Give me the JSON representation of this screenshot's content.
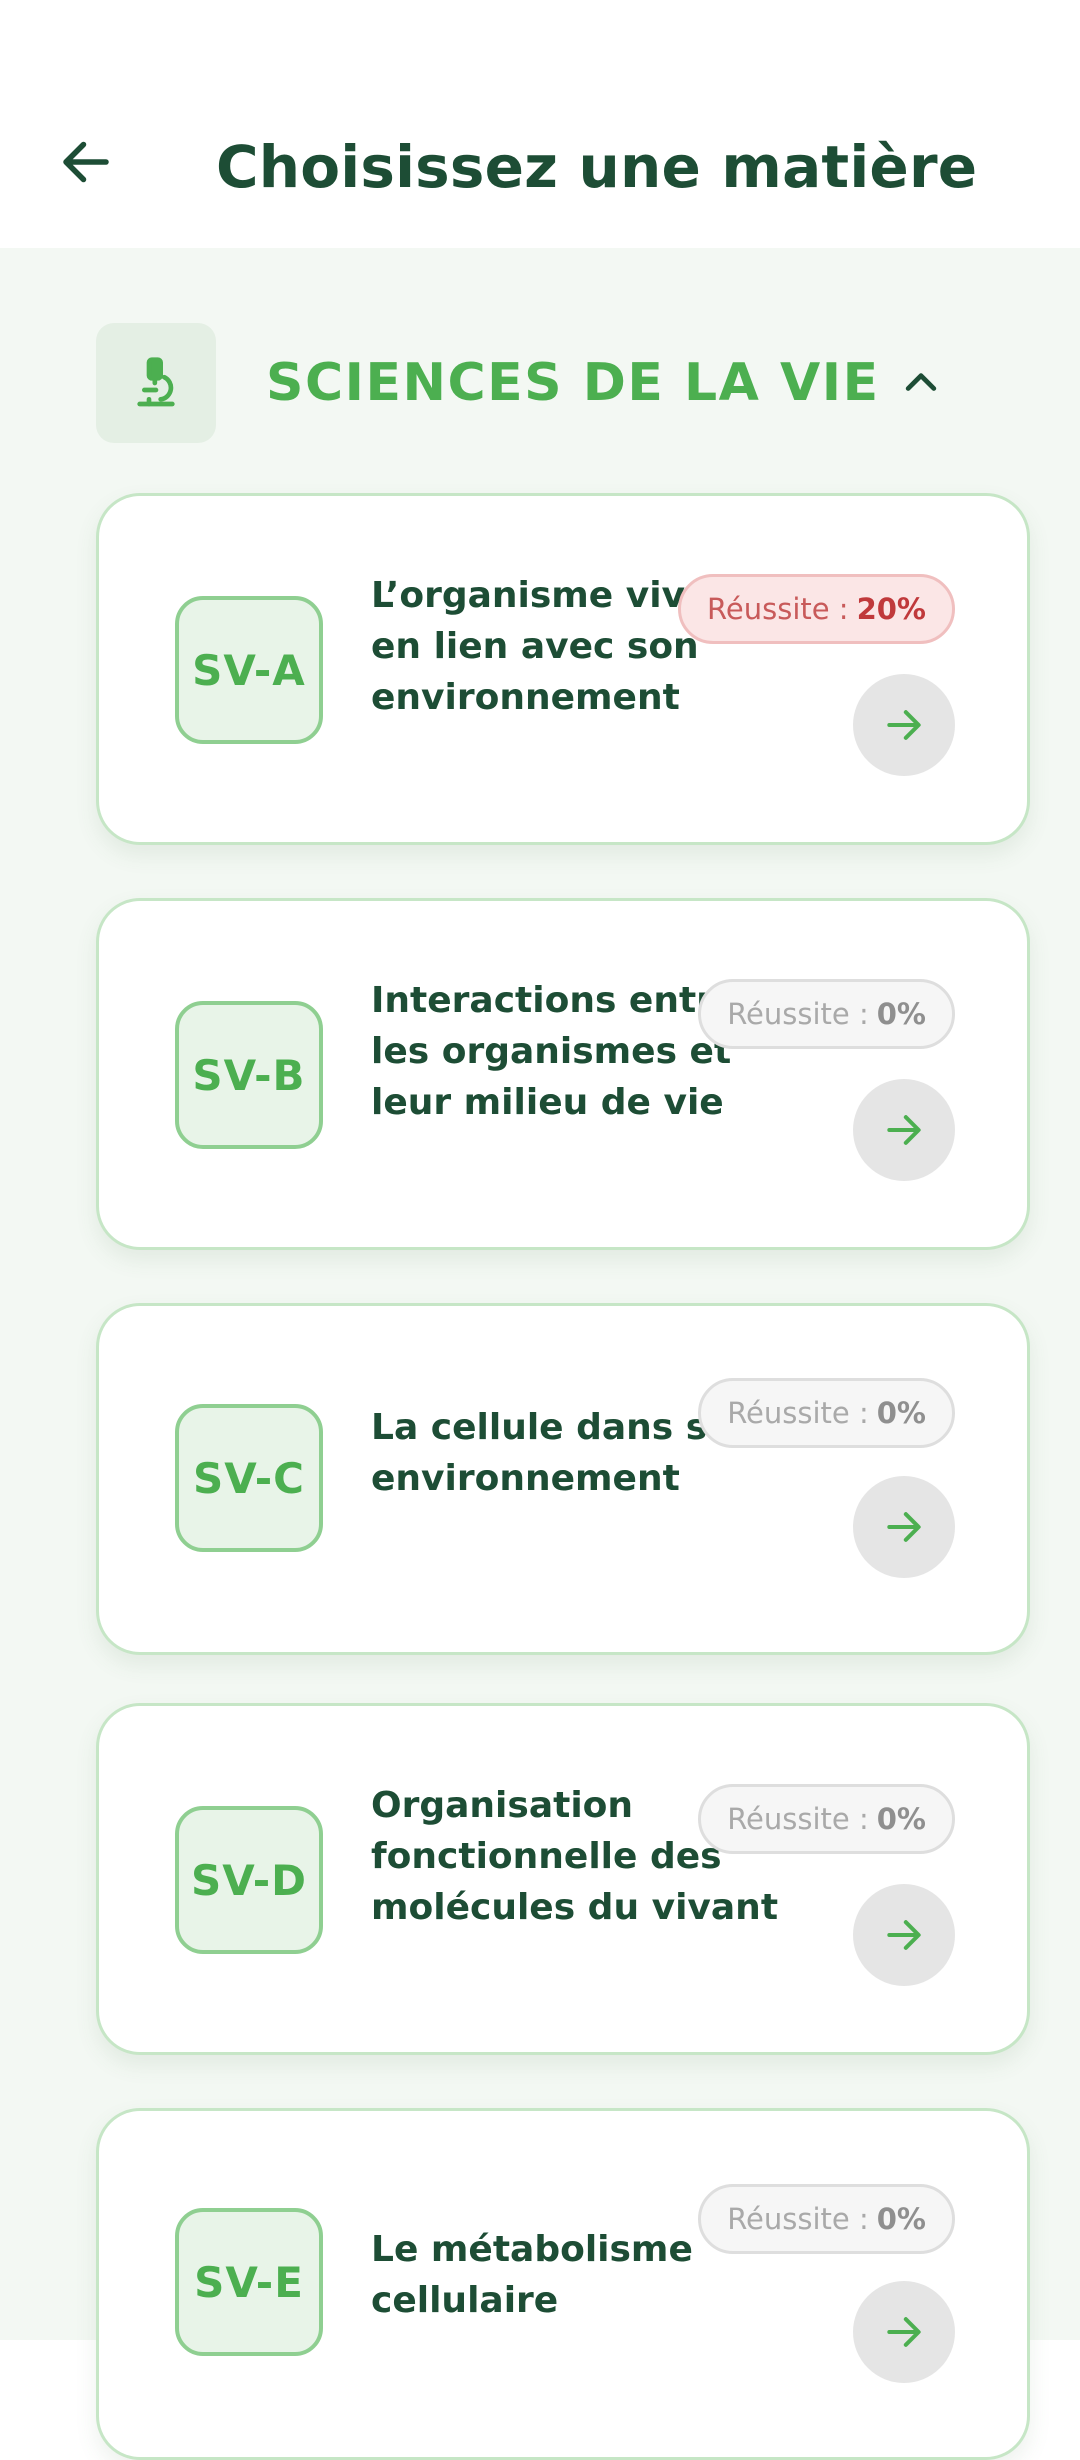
{
  "header": {
    "title": "Choisissez une matière",
    "back_icon": "arrow-left-icon"
  },
  "section": {
    "title": "SCIENCES DE LA VIE",
    "icon": "microscope-icon",
    "toggle_icon": "chevron-up-icon",
    "expanded": true
  },
  "colors": {
    "primary_dark": "#1d4d35",
    "accent_green": "#4caf50",
    "background": "#f3f8f3",
    "score_low_text": "#c0393b",
    "score_zero_text": "#8f8f8f"
  },
  "subjects": [
    {
      "code": "SV-A",
      "title": "L’organisme vivant en lien avec son environnement",
      "score_label": "Réussite :",
      "score_value": "20%",
      "score_percent": 20,
      "arrow_icon": "arrow-right-icon"
    },
    {
      "code": "SV-B",
      "title": "Interactions entre les organismes et leur milieu de vie",
      "score_label": "Réussite :",
      "score_value": "0%",
      "score_percent": 0,
      "arrow_icon": "arrow-right-icon"
    },
    {
      "code": "SV-C",
      "title": "La cellule dans son environnement",
      "score_label": "Réussite :",
      "score_value": "0%",
      "score_percent": 0,
      "arrow_icon": "arrow-right-icon"
    },
    {
      "code": "SV-D",
      "title": "Organisation fonctionnelle des molécules du vivant",
      "score_label": "Réussite :",
      "score_value": "0%",
      "score_percent": 0,
      "arrow_icon": "arrow-right-icon"
    },
    {
      "code": "SV-E",
      "title": "Le métabolisme cellulaire",
      "score_label": "Réussite :",
      "score_value": "0%",
      "score_percent": 0,
      "arrow_icon": "arrow-right-icon"
    }
  ]
}
